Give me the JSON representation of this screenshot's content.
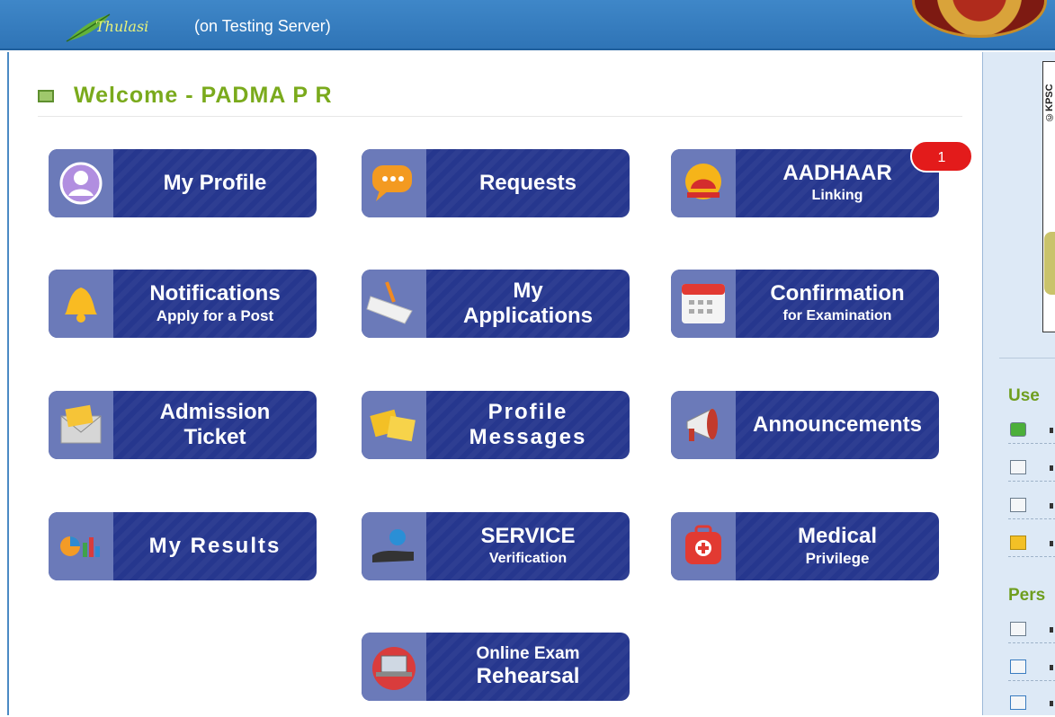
{
  "header": {
    "app_name": "Thulasi",
    "server_note": "(on Testing Server)"
  },
  "welcome": {
    "text": "Welcome - PADMA P R"
  },
  "tiles": [
    {
      "icon": "profile-icon",
      "line1": "My Profile",
      "line2": ""
    },
    {
      "icon": "chat-icon",
      "line1": "Requests",
      "line2": ""
    },
    {
      "icon": "aadhaar-icon",
      "line1": "AADHAAR",
      "line2": "Linking",
      "badge": "1"
    },
    {
      "icon": "bell-icon",
      "line1": "Notifications",
      "line2": "Apply for a Post"
    },
    {
      "icon": "form-icon",
      "line1": "My",
      "line2": "Applications"
    },
    {
      "icon": "calendar-icon",
      "line1": "Confirmation",
      "line2": "for Examination"
    },
    {
      "icon": "envelope-icon",
      "line1": "Admission",
      "line2": "Ticket"
    },
    {
      "icon": "notes-icon",
      "line1": "Profile",
      "line2": "Messages"
    },
    {
      "icon": "megaphone-icon",
      "line1": "Announcements",
      "line2": ""
    },
    {
      "icon": "chart-icon",
      "line1": "My Results",
      "line2": ""
    },
    {
      "icon": "hand-gear-icon",
      "line1": "SERVICE",
      "line2": "Verification"
    },
    {
      "icon": "medical-bag-icon",
      "line1": "Medical",
      "line2": "Privilege"
    },
    {
      "icon": "laptop-icon",
      "line1": "Online Exam",
      "line2": "Rehearsal"
    }
  ],
  "sidebar": {
    "photo_label": "©KPSC",
    "section1": "Use",
    "section2": "Pers",
    "items1": [
      "user-icon",
      "document-icon",
      "card-icon",
      "edit-icon"
    ],
    "items2": [
      "mail-icon",
      "edit-form-icon",
      "file-icon"
    ]
  },
  "colors": {
    "tile": "#26378e",
    "icon_pane": "#6b7ab9",
    "header": "#3f87c8",
    "welcome": "#7aaa1c",
    "badge": "#e31b1b"
  }
}
